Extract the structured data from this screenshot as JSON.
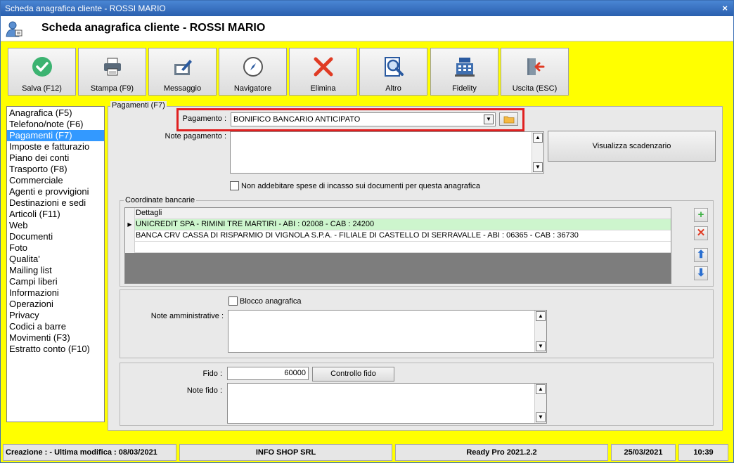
{
  "window": {
    "title": "Scheda anagrafica cliente - ROSSI MARIO",
    "close_glyph": "×"
  },
  "header": {
    "title": "Scheda anagrafica cliente - ROSSI MARIO",
    "icon": "user-card-icon"
  },
  "toolbar": {
    "buttons": [
      {
        "label": "Salva (F12)",
        "icon": "check-circle-icon"
      },
      {
        "label": "Stampa (F9)",
        "icon": "printer-icon"
      },
      {
        "label": "Messaggio",
        "icon": "message-edit-icon"
      },
      {
        "label": "Navigatore",
        "icon": "compass-icon"
      },
      {
        "label": "Elimina",
        "icon": "delete-x-icon"
      },
      {
        "label": "Altro",
        "icon": "search-document-icon"
      },
      {
        "label": "Fidelity",
        "icon": "cash-register-icon"
      },
      {
        "label": "Uscita (ESC)",
        "icon": "exit-door-icon"
      }
    ]
  },
  "nav": {
    "items": [
      {
        "label": "Anagrafica (F5)"
      },
      {
        "label": "Telefono/note (F6)"
      },
      {
        "label": "Pagamenti (F7)"
      },
      {
        "label": "Imposte e fatturazio"
      },
      {
        "label": "Piano dei conti"
      },
      {
        "label": "Trasporto (F8)"
      },
      {
        "label": "Commerciale"
      },
      {
        "label": "Agenti e provvigioni"
      },
      {
        "label": "Destinazioni e sedi"
      },
      {
        "label": "Articoli (F11)"
      },
      {
        "label": "Web"
      },
      {
        "label": "Documenti"
      },
      {
        "label": "Foto"
      },
      {
        "label": "Qualita'"
      },
      {
        "label": "Mailing list"
      },
      {
        "label": "Campi liberi"
      },
      {
        "label": "Informazioni"
      },
      {
        "label": "Operazioni"
      },
      {
        "label": "Privacy"
      },
      {
        "label": "Codici a barre"
      },
      {
        "label": "Movimenti (F3)"
      },
      {
        "label": "Estratto conto (F10)"
      }
    ],
    "selected": "Pagamenti (F7)"
  },
  "payments": {
    "section_label": "Pagamenti (F7)",
    "pagamento_label": "Pagamento :",
    "pagamento_value": "BONIFICO BANCARIO ANTICIPATO",
    "note_pagamento_label": "Note pagamento :",
    "note_pagamento_value": "",
    "visualizza_button": "Visualizza scadenzario",
    "no_spese_label": "Non addebitare spese di incasso sui documenti per questa anagrafica",
    "no_spese_checked": false
  },
  "coordinate_bancarie": {
    "label": "Coordinate bancarie",
    "column_header": "Dettagli",
    "rows": [
      "UNICREDIT SPA - RIMINI TRE MARTIRI - ABI : 02008 - CAB : 24200",
      "BANCA CRV CASSA DI RISPARMIO DI VIGNOLA S.P.A. - FILIALE DI CASTELLO DI SERRAVALLE - ABI : 06365 - CAB : 36730"
    ],
    "selected_row": 0,
    "side_buttons": [
      "add-icon",
      "remove-icon",
      "move-up-icon",
      "move-down-icon"
    ]
  },
  "admin": {
    "blocco_label": "Blocco anagrafica",
    "blocco_checked": false,
    "note_amm_label": "Note amministrative :",
    "note_amm_value": ""
  },
  "fido": {
    "fido_label": "Fido :",
    "fido_value": "60000",
    "controllo_button": "Controllo fido",
    "note_fido_label": "Note fido :",
    "note_fido_value": ""
  },
  "status": {
    "creazione": "Creazione :  - Ultima modifica : 08/03/2021",
    "company": "INFO SHOP SRL",
    "version": "Ready Pro 2021.2.2",
    "date": "25/03/2021",
    "time": "10:39"
  },
  "colors": {
    "background": "#ffff00",
    "highlight": "#e02020",
    "selected_nav": "#3399ff",
    "selected_row": "#cdf5cd"
  }
}
